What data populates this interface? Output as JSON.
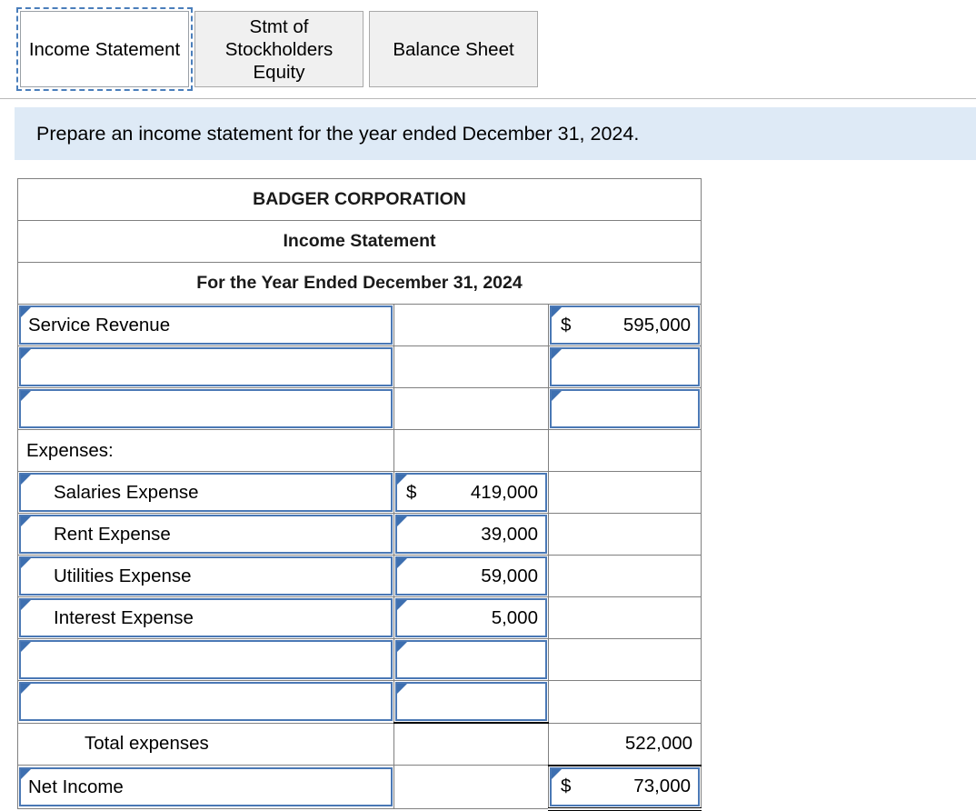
{
  "tabs": [
    {
      "label": "Income Statement",
      "active": true
    },
    {
      "label": "Stmt of Stockholders Equity",
      "active": false
    },
    {
      "label": "Balance Sheet",
      "active": false
    }
  ],
  "instruction": "Prepare an income statement for the year ended December 31, 2024.",
  "statement": {
    "company": "BADGER CORPORATION",
    "title": "Income Statement",
    "period": "For the Year Ended December 31, 2024",
    "rows": [
      {
        "label": "Service Revenue",
        "mid": "",
        "right_currency": "$",
        "right": "595,000"
      },
      {
        "label": "",
        "mid": "",
        "right_currency": "",
        "right": ""
      },
      {
        "label": "",
        "mid": "",
        "right_currency": "",
        "right": ""
      },
      {
        "label": "Expenses:",
        "mid": "",
        "right_currency": "",
        "right": ""
      },
      {
        "label": "Salaries Expense",
        "mid_currency": "$",
        "mid": "419,000",
        "right_currency": "",
        "right": ""
      },
      {
        "label": "Rent Expense",
        "mid_currency": "",
        "mid": "39,000",
        "right_currency": "",
        "right": ""
      },
      {
        "label": "Utilities Expense",
        "mid_currency": "",
        "mid": "59,000",
        "right_currency": "",
        "right": ""
      },
      {
        "label": "Interest Expense",
        "mid_currency": "",
        "mid": "5,000",
        "right_currency": "",
        "right": ""
      },
      {
        "label": "",
        "mid_currency": "",
        "mid": "",
        "right_currency": "",
        "right": ""
      },
      {
        "label": "",
        "mid_currency": "",
        "mid": "",
        "right_currency": "",
        "right": ""
      },
      {
        "label": "Total expenses",
        "mid": "",
        "right_currency": "",
        "right": "522,000"
      },
      {
        "label": "Net Income",
        "mid": "",
        "right_currency": "$",
        "right": "73,000"
      }
    ]
  },
  "colors": {
    "header_blue": "#83a9de",
    "instruction_blue": "#deeaf6",
    "field_border": "#4a78b5",
    "grid_gray": "#808080"
  }
}
